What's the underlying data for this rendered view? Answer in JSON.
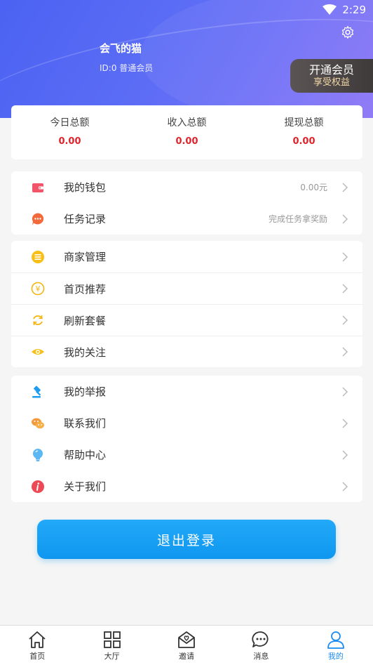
{
  "status_bar": {
    "time": "2:29"
  },
  "profile": {
    "username": "会飞的猫",
    "id_text": "ID:0 普通会员",
    "vip_title": "开通会员",
    "vip_subtitle": "享受权益"
  },
  "stats": [
    {
      "label": "今日总额",
      "value": "0.00"
    },
    {
      "label": "收入总额",
      "value": "0.00"
    },
    {
      "label": "提现总额",
      "value": "0.00"
    }
  ],
  "group1": [
    {
      "label": "我的钱包",
      "value": "0.00元",
      "icon": "wallet-icon"
    },
    {
      "label": "任务记录",
      "value": "完成任务拿奖励",
      "icon": "chat-bubble-icon"
    }
  ],
  "group2": [
    {
      "label": "商家管理",
      "icon": "list-circle-icon"
    },
    {
      "label": "首页推荐",
      "icon": "yen-circle-icon"
    },
    {
      "label": "刷新套餐",
      "icon": "refresh-icon"
    },
    {
      "label": "我的关注",
      "icon": "eye-icon"
    }
  ],
  "group3": [
    {
      "label": "我的举报",
      "icon": "gavel-icon"
    },
    {
      "label": "联系我们",
      "icon": "wechat-icon"
    },
    {
      "label": "帮助中心",
      "icon": "lightbulb-icon"
    },
    {
      "label": "关于我们",
      "icon": "info-icon"
    }
  ],
  "logout_label": "退出登录",
  "tabs": [
    {
      "label": "首页",
      "icon": "home-icon"
    },
    {
      "label": "大厅",
      "icon": "grid-icon"
    },
    {
      "label": "邀请",
      "icon": "invite-envelope-icon"
    },
    {
      "label": "消息",
      "icon": "message-icon"
    },
    {
      "label": "我的",
      "icon": "user-icon",
      "active": true
    }
  ],
  "colors": {
    "header_gradient_start": "#4b62f2",
    "header_gradient_end": "#8a73f6",
    "stat_value": "#e0242c",
    "primary_button": "#1a9ff5",
    "active_tab": "#1a8cf0"
  }
}
